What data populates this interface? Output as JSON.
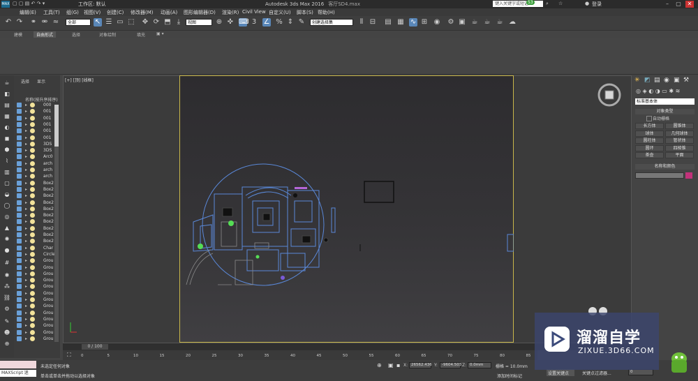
{
  "window": {
    "workspace": "工作区: 默认",
    "app_title": "Autodesk 3ds Max 2016",
    "file_name": "客厅SD4.max",
    "search_placeholder": "键入关键字或短语",
    "login": "登录",
    "badge": "53"
  },
  "menu": [
    "编辑(E)",
    "工具(T)",
    "组(G)",
    "视图(V)",
    "创建(C)",
    "修改器(M)",
    "动画(A)",
    "图形编辑器(D)",
    "渲染(R)",
    "Civil View",
    "自定义(U)",
    "脚本(S)",
    "帮助(H)"
  ],
  "toolbar": {
    "filter_combo": "全部",
    "refcoord_combo": "视图",
    "selection_set_combo": "创建选择集"
  },
  "ribbon_tabs": [
    "建模",
    "自由形式",
    "选择",
    "对象绘制",
    "填充"
  ],
  "ribbon_active": "自由形式",
  "scene_explorer": {
    "tabs": [
      "选择",
      "显示"
    ],
    "column_header": "名称(按升序排序)",
    "items": [
      "000",
      "001",
      "001",
      "001",
      "001",
      "001",
      "3DS",
      "3DS",
      "Arc0",
      "arch",
      "arch",
      "arch",
      "Box2",
      "Box2",
      "Box2",
      "Box2",
      "Box2",
      "Box2",
      "Box2",
      "Box2",
      "Box2",
      "Box2",
      "Char",
      "Circle",
      "Grou",
      "Grou",
      "Grou",
      "Grou",
      "Grou",
      "Grou",
      "Grou",
      "Grou",
      "Grou",
      "Grou",
      "Grou",
      "Grou",
      "Grou"
    ]
  },
  "viewport": {
    "label": "[+] [顶] [线框]"
  },
  "command_panel": {
    "dropdown": "标准基本体",
    "object_type_title": "对象类型",
    "autogrid": "自动栅格",
    "buttons": [
      "长方体",
      "圆锥体",
      "球体",
      "几何球体",
      "圆柱体",
      "管状体",
      "圆环",
      "四棱锥",
      "茶壶",
      "平面"
    ],
    "name_color_title": "名称和颜色"
  },
  "timeline": {
    "position": "0 / 100",
    "ticks": [
      "0",
      "5",
      "10",
      "15",
      "20",
      "25",
      "30",
      "35",
      "40",
      "45",
      "50",
      "55",
      "60",
      "65",
      "70",
      "75",
      "80",
      "85"
    ]
  },
  "status": {
    "maxscript": "MAXScript 迷",
    "line1": "未选定任何对象",
    "line2": "单击或单击并拖动以选择对象",
    "x_label": "X:",
    "x_value": "26562.436",
    "y_label": "Y:",
    "y_value": "-9604.503",
    "z_label": "Z:",
    "z_value": "0.0mm",
    "grid": "栅格 = 10.0mm",
    "add_time_tag": "添加时间标记",
    "set_key": "设置关键点",
    "key_filters": "关键点过滤器...",
    "frame": "0"
  },
  "watermark": {
    "title": "溜溜自学",
    "subtitle": "ZIXUE.3D66.COM"
  }
}
